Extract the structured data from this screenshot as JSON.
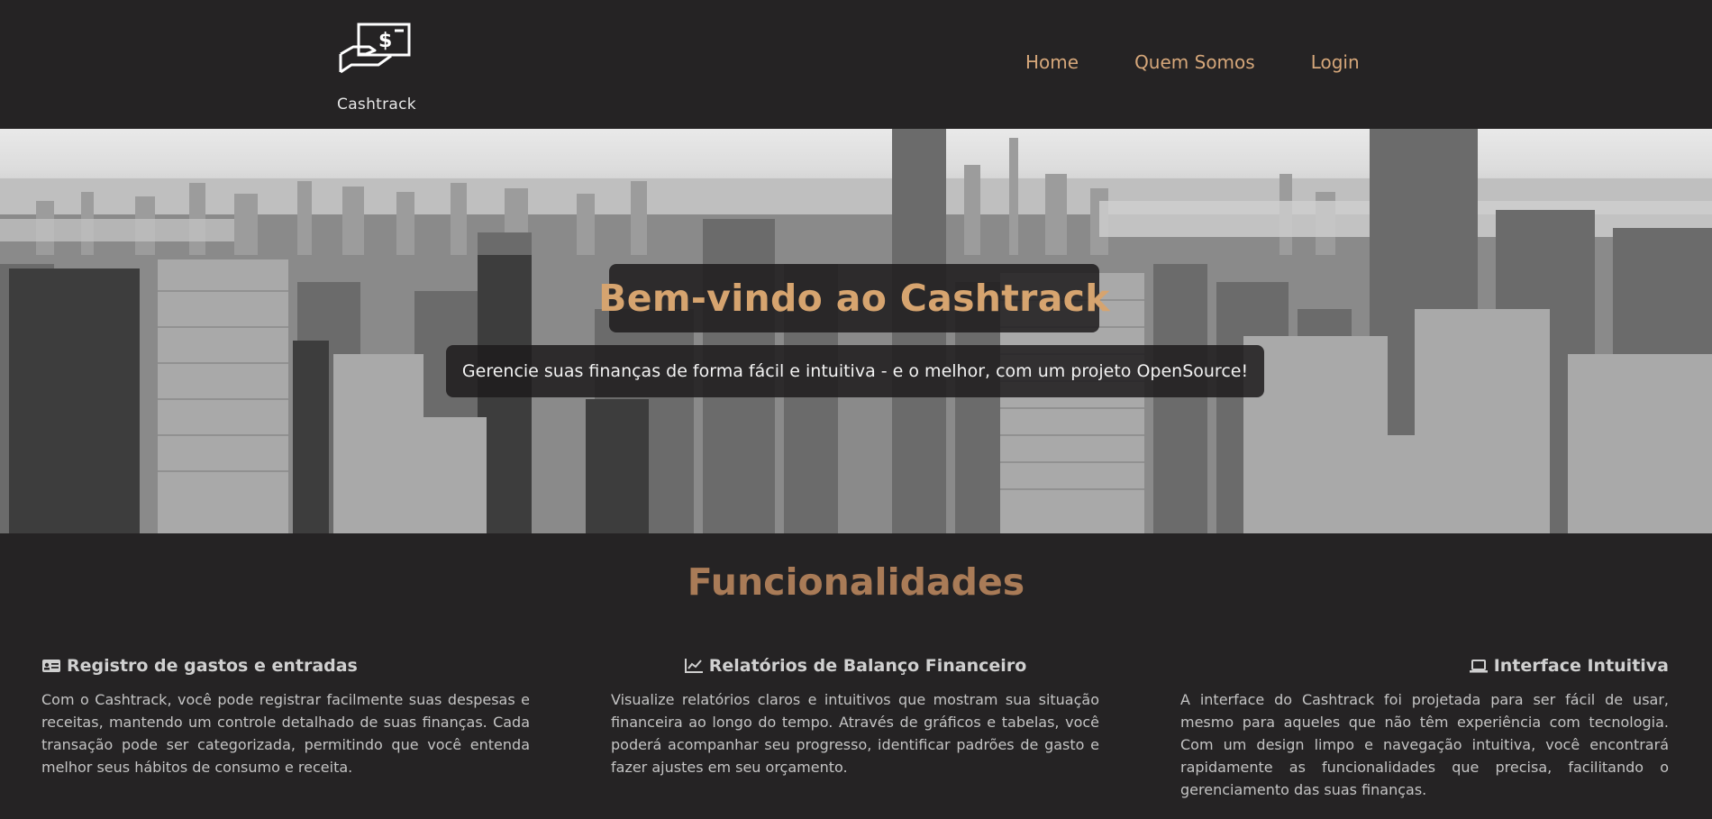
{
  "brand": {
    "name": "Cashtrack",
    "logo_icon": "hand-holding-dollar-bill-icon"
  },
  "nav": {
    "items": [
      {
        "label": "Home"
      },
      {
        "label": "Quem Somos"
      },
      {
        "label": "Login"
      }
    ]
  },
  "hero": {
    "title": "Bem-vindo ao Cashtrack",
    "subtitle": "Gerencie suas finanças de forma fácil e intuitiva - e o melhor, com um projeto OpenSource!",
    "background": "grayscale city skyline photo"
  },
  "features": {
    "title": "Funcionalidades",
    "items": [
      {
        "icon": "id-card-icon",
        "title": "Registro de gastos e entradas",
        "text": "Com o Cashtrack, você pode registrar facilmente suas despesas e receitas, mantendo um controle detalhado de suas finanças. Cada transação pode ser categorizada, permitindo que você entenda melhor seus hábitos de consumo e receita."
      },
      {
        "icon": "line-chart-icon",
        "title": "Relatórios de Balanço Financeiro",
        "text": "Visualize relatórios claros e intuitivos que mostram sua situação financeira ao longo do tempo. Através de gráficos e tabelas, você poderá acompanhar seu progresso, identificar padrões de gasto e fazer ajustes em seu orçamento."
      },
      {
        "icon": "laptop-icon",
        "title": "Interface Intuitiva",
        "text": "A interface do Cashtrack foi projetada para ser fácil de usar, mesmo para aqueles que não têm experiência com tecnologia. Com um design limpo e navegação intuitiva, você encontrará rapidamente as funcionalidades que precisa, facilitando o gerenciamento das suas finanças."
      }
    ]
  },
  "colors": {
    "background": "#252324",
    "accent": "#d6a46f",
    "nav_link": "#d6a77a",
    "section_title": "#a97b57"
  }
}
